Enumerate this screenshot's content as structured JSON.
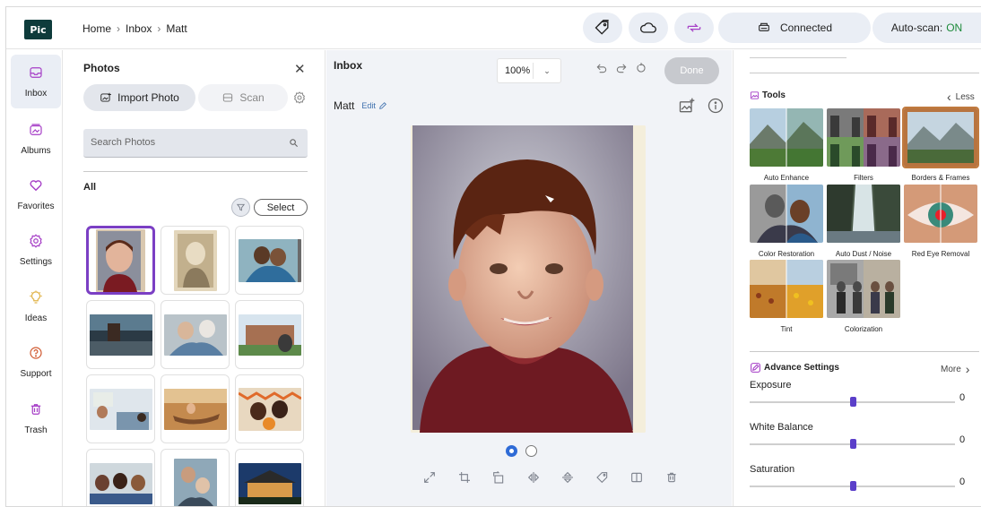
{
  "app": {
    "logo_text": "Pic"
  },
  "breadcrumb": [
    "Home",
    "Inbox",
    "Matt"
  ],
  "header": {
    "connection_label": "Connected",
    "autoscan_prefix": "Auto-scan:",
    "autoscan_state": "ON",
    "colors": {
      "pill_bg": "#eaeef5",
      "accent_purple": "#a53dc6",
      "on_green": "#1d8a3a"
    }
  },
  "nav": [
    {
      "label": "Inbox",
      "icon": "inbox-icon",
      "active": true
    },
    {
      "label": "Albums",
      "icon": "albums-icon",
      "active": false
    },
    {
      "label": "Favorites",
      "icon": "heart-icon",
      "active": false
    },
    {
      "label": "Settings",
      "icon": "gear-icon",
      "active": false
    },
    {
      "label": "Ideas",
      "icon": "lightbulb-icon",
      "active": false
    },
    {
      "label": "Support",
      "icon": "question-icon",
      "active": false
    },
    {
      "label": "Trash",
      "icon": "trash-icon",
      "active": false
    }
  ],
  "photos_panel": {
    "title": "Photos",
    "import_label": "Import Photo",
    "scan_label": "Scan",
    "search_placeholder": "Search Photos",
    "all_label": "All",
    "select_label": "Select"
  },
  "editor": {
    "title": "Inbox",
    "zoom": "100%",
    "done_label": "Done",
    "photo_name": "Matt",
    "edit_label": "Edit"
  },
  "tools": {
    "title": "Tools",
    "less_label": "Less",
    "items": [
      {
        "label": "Auto Enhance"
      },
      {
        "label": "Filters"
      },
      {
        "label": "Borders & Frames"
      },
      {
        "label": "Color Restoration"
      },
      {
        "label": "Auto Dust / Noise"
      },
      {
        "label": "Red Eye Removal"
      },
      {
        "label": "Tint"
      },
      {
        "label": "Colorization"
      }
    ]
  },
  "advanced": {
    "title": "Advance Settings",
    "more_label": "More",
    "sliders": [
      {
        "label": "Exposure",
        "value": "0",
        "fraction": 0.5
      },
      {
        "label": "White Balance",
        "value": "0",
        "fraction": 0.5
      },
      {
        "label": "Saturation",
        "value": "0",
        "fraction": 0.5
      }
    ]
  }
}
